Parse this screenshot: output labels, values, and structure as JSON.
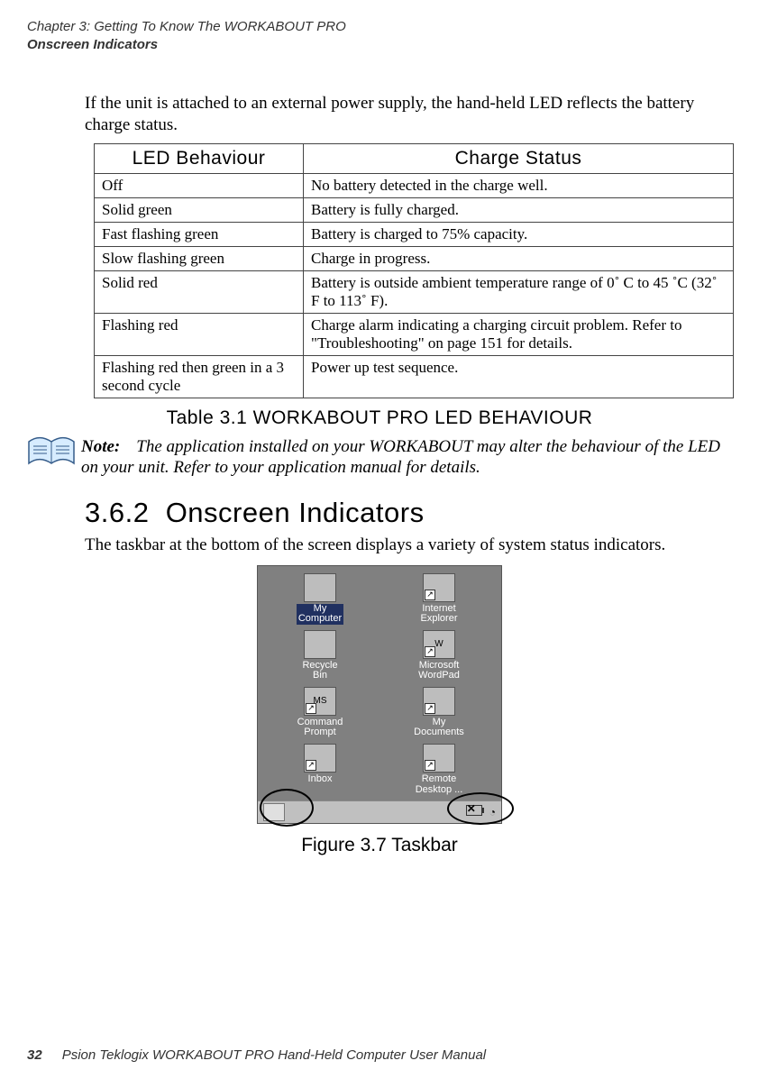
{
  "running_head": {
    "line1": "Chapter 3:  Getting To Know The WORKABOUT PRO",
    "line2": "Onscreen Indicators"
  },
  "intro_para": "If the unit is attached to an external power supply, the hand-held LED reflects the battery charge status.",
  "table": {
    "headers": {
      "col1": "LED Behaviour",
      "col2": "Charge Status"
    },
    "rows": [
      {
        "c1": "Off",
        "c2": "No battery detected in the charge well."
      },
      {
        "c1": "Solid green",
        "c2": "Battery is fully charged."
      },
      {
        "c1": "Fast flashing green",
        "c2": "Battery is charged to 75% capacity."
      },
      {
        "c1": "Slow flashing green",
        "c2": "Charge in progress."
      },
      {
        "c1": "Solid red",
        "c2": "Battery is outside ambient temperature range of 0˚ C to 45 ˚C (32˚ F to 113˚ F)."
      },
      {
        "c1": "Flashing red",
        "c2": "Charge alarm indicating a charging circuit problem. Refer to \"Troubleshooting\" on page 151 for details."
      },
      {
        "c1": "Flashing red then green in a 3 second cycle",
        "c2": "Power up test sequence."
      }
    ],
    "caption": "Table 3.1  WORKABOUT PRO LED BEHAVIOUR"
  },
  "note": {
    "label": "Note:",
    "text": "The application installed on your WORKABOUT may alter the behaviour of the LED on your unit. Refer to your application manual for details."
  },
  "section": {
    "number": "3.6.2",
    "title": "Onscreen Indicators",
    "para": "The taskbar at the bottom of the screen displays a variety of system status indicators."
  },
  "figure": {
    "caption": "Figure 3.7 Taskbar",
    "desktop_icons": [
      {
        "label": "My Computer",
        "selected": true,
        "shortcut": false,
        "badge": ""
      },
      {
        "label": "Internet Explorer",
        "selected": false,
        "shortcut": true,
        "badge": ""
      },
      {
        "label": "Recycle Bin",
        "selected": false,
        "shortcut": false,
        "badge": ""
      },
      {
        "label": "Microsoft WordPad",
        "selected": false,
        "shortcut": true,
        "badge": "W"
      },
      {
        "label": "Command Prompt",
        "selected": false,
        "shortcut": true,
        "badge": "MS"
      },
      {
        "label": "My Documents",
        "selected": false,
        "shortcut": true,
        "badge": ""
      },
      {
        "label": "Inbox",
        "selected": false,
        "shortcut": true,
        "badge": ""
      },
      {
        "label": "Remote Desktop ...",
        "selected": false,
        "shortcut": true,
        "badge": ""
      }
    ],
    "tray": {
      "battery_crossed": "✕",
      "clock_glyph": "◔"
    }
  },
  "footer": {
    "page": "32",
    "title": "Psion Teklogix WORKABOUT PRO Hand-Held Computer User Manual"
  }
}
